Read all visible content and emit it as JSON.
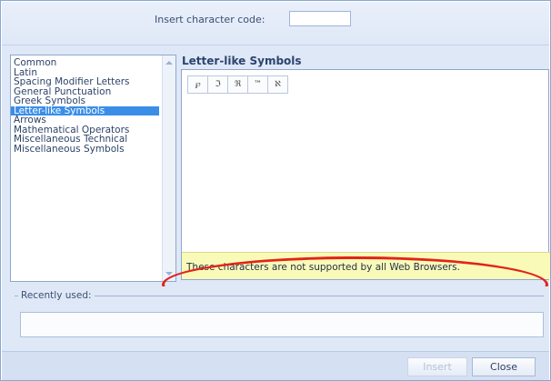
{
  "header": {
    "code_label": "Insert character code:",
    "code_value": ""
  },
  "categories": [
    "Common",
    "Latin",
    "Spacing Modifier Letters",
    "General Punctuation",
    "Greek Symbols",
    "Letter-like Symbols",
    "Arrows",
    "Mathematical Operators",
    "Miscellaneous Technical",
    "Miscellaneous Symbols"
  ],
  "selected_category": "Letter-like Symbols",
  "symbols_panel": {
    "title": "Letter-like Symbols",
    "symbols": [
      "℘",
      "ℑ",
      "ℜ",
      "™",
      "ℵ"
    ],
    "note": "These characters are not supported by all Web Browsers."
  },
  "recent": {
    "legend": "Recently used:"
  },
  "footer": {
    "insert_label": "Insert",
    "close_label": "Close"
  },
  "colors": {
    "selection": "#3a8ee8",
    "note_background": "#fafab8",
    "highlight": "#e2231a"
  }
}
